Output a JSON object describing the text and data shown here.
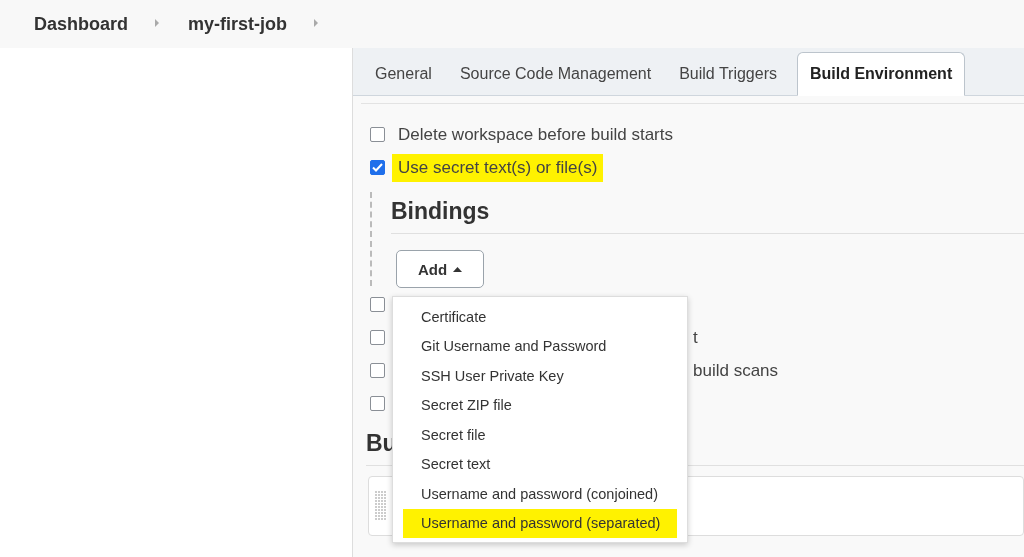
{
  "breadcrumb": [
    {
      "label": "Dashboard"
    },
    {
      "label": "my-first-job"
    }
  ],
  "tabs": [
    {
      "label": "General",
      "selected": false
    },
    {
      "label": "Source Code Management",
      "selected": false
    },
    {
      "label": "Build Triggers",
      "selected": false
    },
    {
      "label": "Build Environment",
      "selected": true
    }
  ],
  "options": [
    {
      "label": "Delete workspace before build starts",
      "checked": false,
      "highlighted": false
    },
    {
      "label": "Use secret text(s) or file(s)",
      "checked": true,
      "highlighted": true
    }
  ],
  "bindings": {
    "heading": "Bindings",
    "add_button": "Add"
  },
  "menu": [
    {
      "label": "Certificate",
      "selected": false
    },
    {
      "label": "Git Username and Password",
      "selected": false
    },
    {
      "label": "SSH User Private Key",
      "selected": false
    },
    {
      "label": "Secret ZIP file",
      "selected": false
    },
    {
      "label": "Secret file",
      "selected": false
    },
    {
      "label": "Secret text",
      "selected": false
    },
    {
      "label": "Username and password (conjoined)",
      "selected": false
    },
    {
      "label": "Username and password (separated)",
      "selected": true
    }
  ],
  "covered_options": [
    {
      "checked": false
    },
    {
      "label_tail": "t",
      "checked": false
    },
    {
      "label_tail": "build scans",
      "checked": false
    },
    {
      "checked": false
    }
  ],
  "build_heading": "Bu"
}
